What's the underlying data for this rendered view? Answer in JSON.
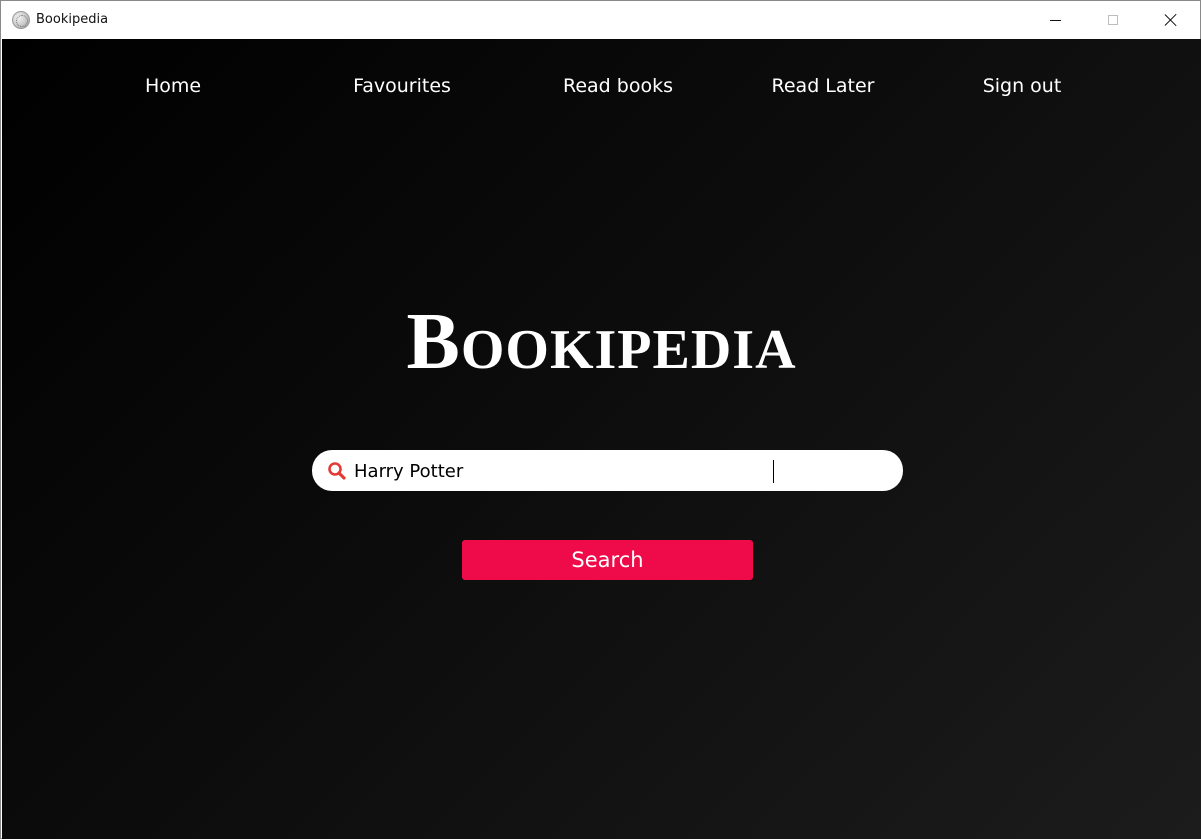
{
  "window": {
    "title": "Bookipedia",
    "icon": "wikipedia-globe-icon"
  },
  "nav": {
    "items": [
      {
        "label": "Home"
      },
      {
        "label": "Favourites"
      },
      {
        "label": "Read books"
      },
      {
        "label": "Read Later"
      },
      {
        "label": "Sign out"
      }
    ]
  },
  "brand": {
    "title": "Bookipedia"
  },
  "search": {
    "value": "Harry Potter",
    "icon": "search-icon",
    "button_label": "Search"
  },
  "colors": {
    "accent": "#ef0a4a",
    "search_icon": "#e53935",
    "background": "#000000",
    "text": "#ffffff"
  }
}
